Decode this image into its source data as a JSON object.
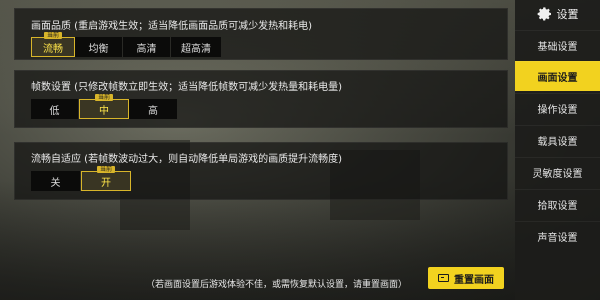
{
  "sidebar": {
    "title": "设置",
    "items": [
      {
        "label": "基础设置",
        "active": false
      },
      {
        "label": "画面设置",
        "active": true
      },
      {
        "label": "操作设置",
        "active": false
      },
      {
        "label": "载具设置",
        "active": false
      },
      {
        "label": "灵敏度设置",
        "active": false
      },
      {
        "label": "拾取设置",
        "active": false
      },
      {
        "label": "声音设置",
        "active": false
      }
    ]
  },
  "quality": {
    "title": "画面品质 (重启游戏生效；适当降低画面品质可减少发热和耗电)",
    "current_tag": "当前",
    "options": [
      "流畅",
      "均衡",
      "高清",
      "超高清"
    ],
    "selected": "流畅"
  },
  "framerate": {
    "title": "帧数设置 (只修改帧数立即生效；适当降低帧数可减少发热量和耗电量)",
    "current_tag": "当前",
    "options": [
      "低",
      "中",
      "高"
    ],
    "selected": "中"
  },
  "adaptive": {
    "title": "流畅自适应 (若帧数波动过大，则自动降低单局游戏的画质提升流畅度)",
    "current_tag": "当前",
    "options": [
      "关",
      "开"
    ],
    "selected": "开"
  },
  "footer": {
    "note": "（若画面设置后游戏体验不佳，或需恢复默认设置，请重置画面）",
    "reset_label": "重置画面"
  },
  "colors": {
    "accent": "#f2d21f",
    "selected_text": "#ffe54a"
  }
}
